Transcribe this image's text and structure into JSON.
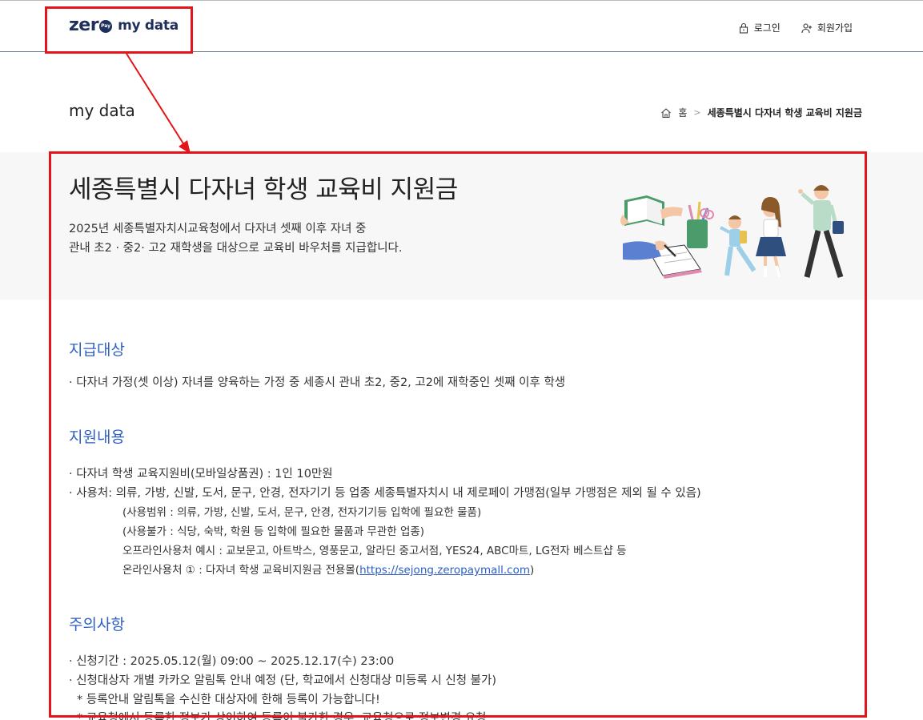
{
  "header": {
    "logo_zero": "zer",
    "logo_pay": "Pay",
    "logo_mydata": "my data",
    "login_label": "로그인",
    "signup_label": "회원가입"
  },
  "page": {
    "title": "my data",
    "breadcrumb": {
      "home": "홈",
      "current": "세종특별시 다자녀 학생 교육비 지원금"
    }
  },
  "hero": {
    "title": "세종특별시 다자녀 학생 교육비 지원금",
    "desc_line1": "2025년 세종특별자치시교육청에서 다자녀 셋째 이후 자녀 중",
    "desc_line2": "관내 초2 · 중2· 고2 재학생을 대상으로 교육비 바우처를 지급합니다."
  },
  "sections": {
    "target": {
      "title": "지급대상",
      "item1": "· 다자녀 가정(셋 이상) 자녀를 양육하는 가정 중 세종시 관내 초2, 중2, 고2에 재학중인 셋째 이후 학생"
    },
    "support": {
      "title": "지원내용",
      "item1": "· 다자녀 학생 교육지원비(모바일상품권) : 1인 10만원",
      "item2": "· 사용처: 의류, 가방, 신발, 도서, 문구, 안경, 전자기기 등 업종 세종특별자치시 내 제로페이 가맹점(일부 가맹점은 제외 될 수 있음)",
      "sub1": "(사용범위 : 의류, 가방, 신발, 도서, 문구, 안경, 전자기기등 입학에 필요한 물품)",
      "sub2": "(사용불가 : 식당, 숙박, 학원 등 입학에 필요한 물품과 무관한 업종)",
      "sub3": "오프라인사용처 예시 : 교보문고, 아트박스, 영풍문고, 알라딘 중고서점, YES24, ABC마트, LG전자 베스트샵 등",
      "sub4_prefix": "온라인사용처 ① : 다자녀 학생 교육비지원금 전용몰(",
      "sub4_link": "https://sejong.zeropaymall.com",
      "sub4_suffix": ")"
    },
    "caution": {
      "title": "주의사항",
      "item1": "· 신청기간 : 2025.05.12(월) 09:00 ~ 2025.12.17(수) 23:00",
      "item2": "· 신청대상자 개별 카카오 알림톡 안내 예정 (단, 학교에서 신청대상 미등록 시 신청 불가)",
      "note1": "* 등록안내 알림톡을 수신한 대상자에 한해 등록이 가능합니다!",
      "note2": "* 교육청에서 등록한 정보가 상이하여 등록이 불가한 경우, 교육청으로 정보변경 요청"
    }
  },
  "colors": {
    "accent_blue": "#2d5fc4",
    "annotation_red": "#e3151a",
    "logo_navy": "#1e2f5a"
  }
}
